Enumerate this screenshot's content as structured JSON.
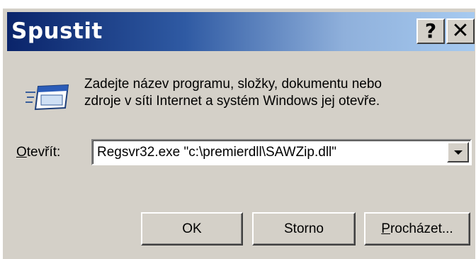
{
  "dialog": {
    "title": "Spustit",
    "help_button": "?",
    "close_button": "✕",
    "description": {
      "line1": "Zadejte název programu, složky, dokumentu nebo",
      "line2": "zdroje v síti Internet a systém Windows jej otevře."
    },
    "open_label": {
      "accesskey": "O",
      "rest": "tevřít:"
    },
    "open_value": "Regsvr32.exe \"c:\\premierdll\\SAWZip.dll\"",
    "buttons": {
      "ok": "OK",
      "cancel": "Storno",
      "browse_accesskey": "P",
      "browse_rest": "rocházet..."
    },
    "colors": {
      "title_gradient_start": "#0a246a",
      "title_gradient_end": "#a6caf0",
      "face": "#d4d0c8"
    },
    "icons": [
      "run-app-icon",
      "help-icon",
      "close-icon",
      "dropdown-arrow-icon"
    ]
  }
}
